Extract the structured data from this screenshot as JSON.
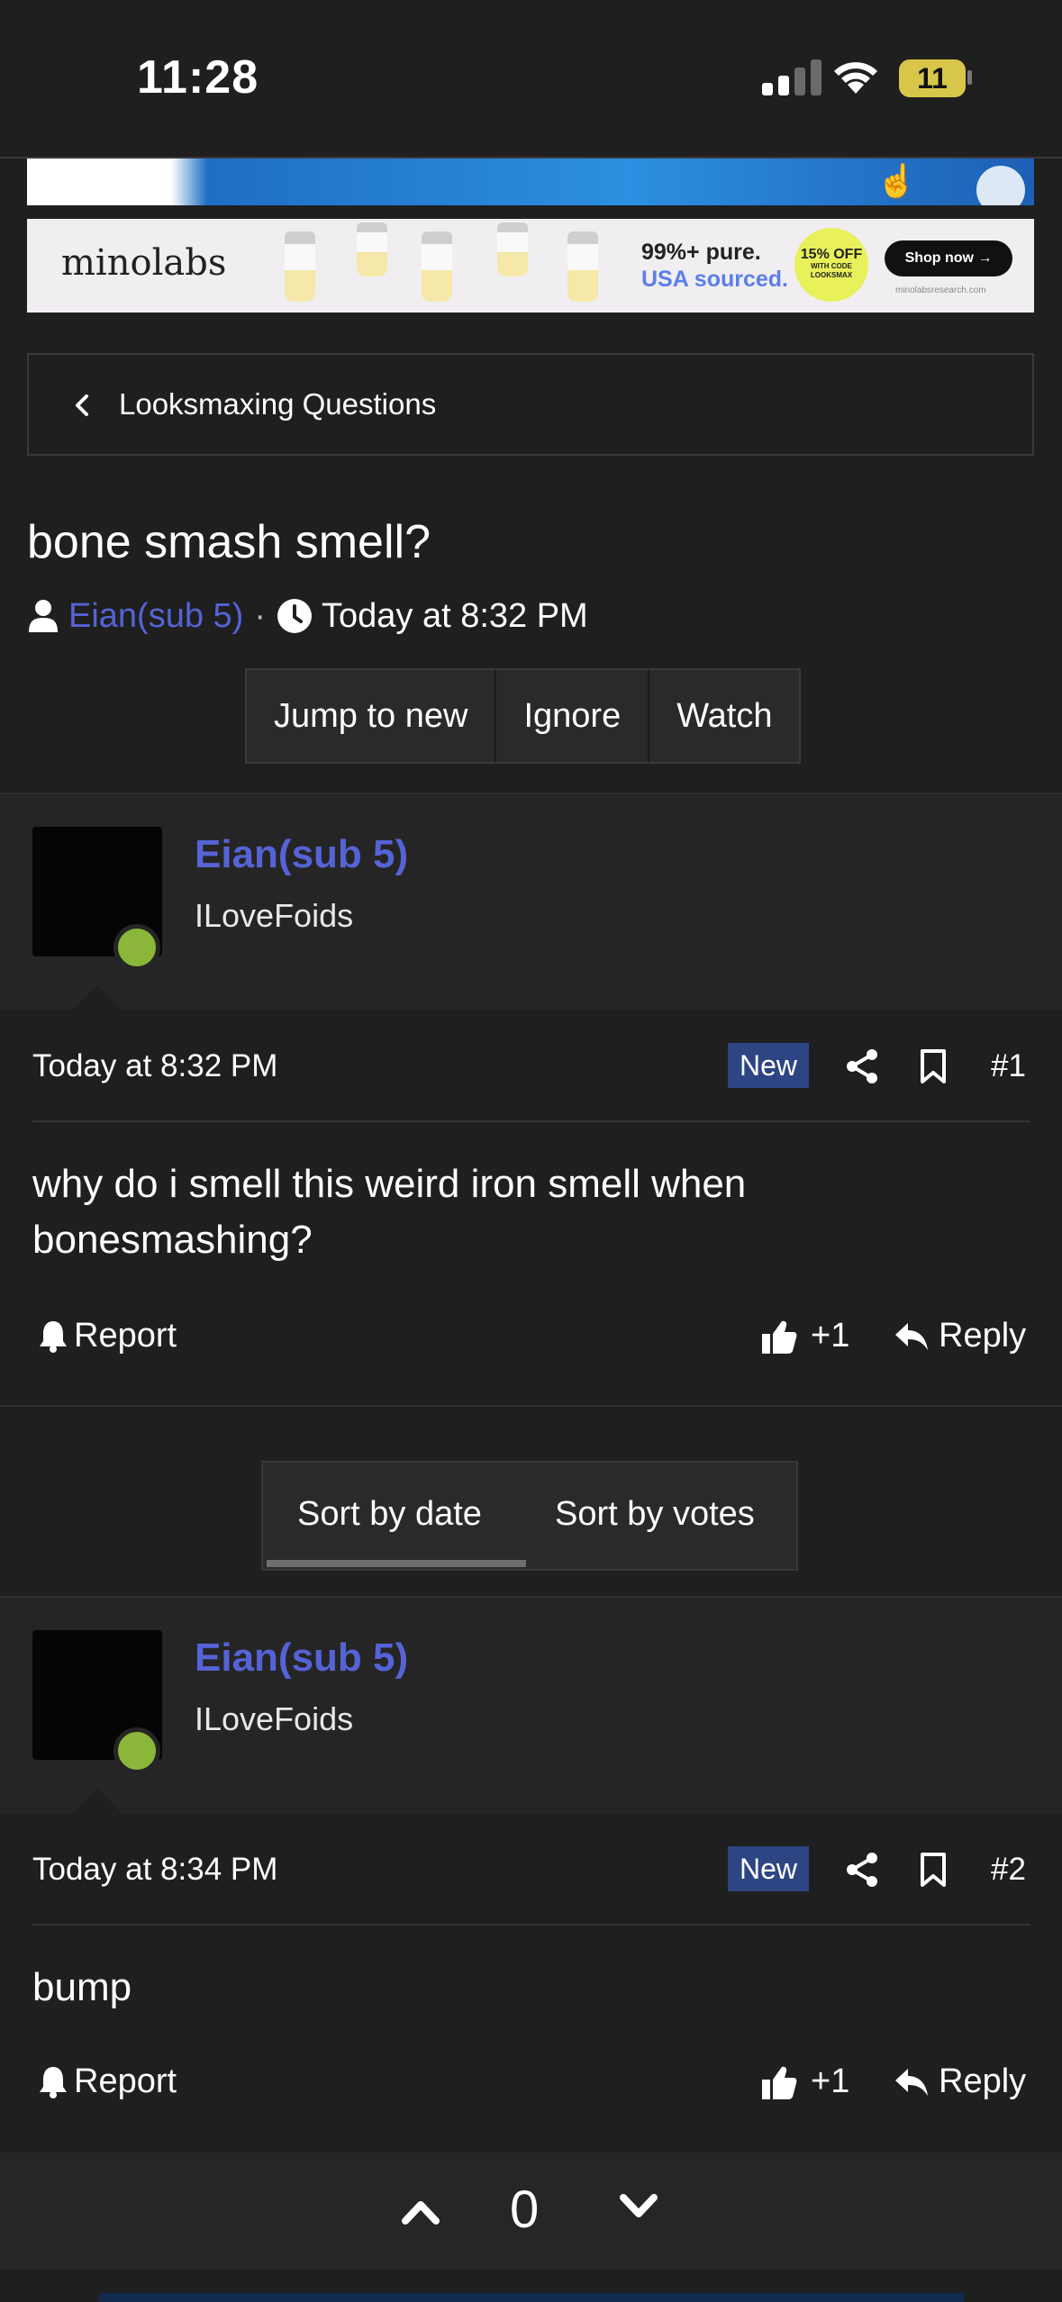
{
  "status_bar": {
    "time": "11:28",
    "battery": "11"
  },
  "ads": {
    "brand": "minolabs",
    "tagline_line1": "99%+ pure.",
    "tagline_line2": "USA sourced.",
    "discount": "15% OFF",
    "discount_small": "WITH CODE LOOKSMAX",
    "shop_label": "Shop now →",
    "site": "minolabsresearch.com"
  },
  "breadcrumb": {
    "label": "Looksmaxing Questions"
  },
  "thread": {
    "title": "bone smash smell?",
    "author": "Eian(sub 5)",
    "separator": "·",
    "date": "Today at 8:32 PM",
    "buttons": {
      "jump": "Jump to new",
      "ignore": "Ignore",
      "watch": "Watch"
    }
  },
  "posts": [
    {
      "username": "Eian(sub 5)",
      "user_title": "ILoveFoids",
      "date": "Today at 8:32 PM",
      "badge": "New",
      "number": "#1",
      "body": "why do i smell this weird iron smell when bonesmashing?",
      "report": "Report",
      "likes": "+1",
      "reply": "Reply"
    },
    {
      "username": "Eian(sub 5)",
      "user_title": "ILoveFoids",
      "date": "Today at 8:34 PM",
      "badge": "New",
      "number": "#2",
      "body": "bump",
      "report": "Report",
      "likes": "+1",
      "reply": "Reply"
    }
  ],
  "sort": {
    "by_date": "Sort by date",
    "by_votes": "Sort by votes",
    "active": "date"
  },
  "votes": {
    "count": "0"
  },
  "colors": {
    "accent": "#5563d6",
    "new_badge": "#2e4584",
    "online": "#8ab73a",
    "background": "#1f1f1f"
  }
}
